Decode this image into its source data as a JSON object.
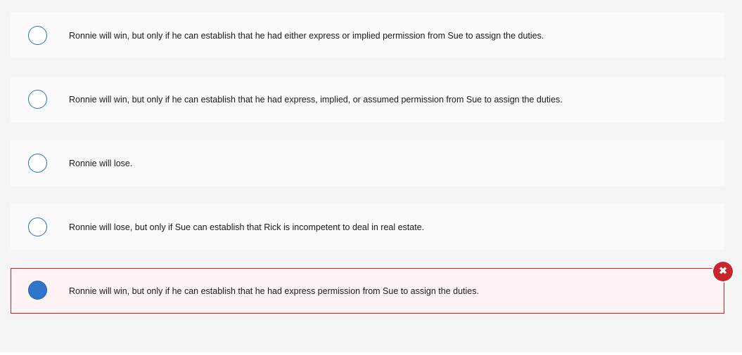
{
  "options": [
    {
      "label": "Ronnie will win, but only if he can establish that he had either express or implied permission from Sue to assign the duties.",
      "selected": false
    },
    {
      "label": "Ronnie will win, but only if he can establish that he had express, implied, or assumed permission from Sue to assign the duties.",
      "selected": false
    },
    {
      "label": "Ronnie will lose.",
      "selected": false
    },
    {
      "label": "Ronnie will lose, but only if Sue can establish that Rick is incompetent to deal in real estate.",
      "selected": false
    },
    {
      "label": "Ronnie will win, but only if he can establish that he had express permission from Sue to assign the duties.",
      "selected": true,
      "status": "incorrect"
    }
  ],
  "feedback": {
    "icon": "x-mark-icon",
    "glyph": "✖"
  },
  "colors": {
    "radio_border": "#2a6ebd",
    "radio_selected_fill": "#2f77c9",
    "incorrect_border": "#c9262c",
    "incorrect_background": "#fff4f4",
    "option_background": "#fafafa",
    "page_background": "#f5f5f5"
  }
}
